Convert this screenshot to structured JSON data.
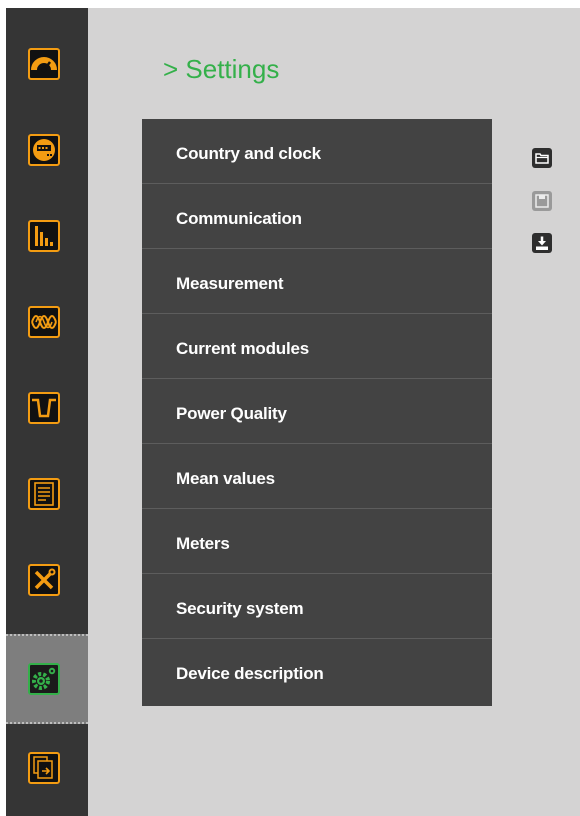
{
  "header": {
    "title": "> Settings"
  },
  "sidebar": {
    "items": [
      {
        "icon": "gauge-icon",
        "active": false
      },
      {
        "icon": "meter-icon",
        "active": false
      },
      {
        "icon": "bar-chart-icon",
        "active": false
      },
      {
        "icon": "waveform-icon",
        "active": false
      },
      {
        "icon": "voltage-dip-icon",
        "active": false
      },
      {
        "icon": "report-list-icon",
        "active": false
      },
      {
        "icon": "tools-icon",
        "active": false
      },
      {
        "icon": "settings-gear-icon",
        "active": true
      },
      {
        "icon": "documents-export-icon",
        "active": false
      }
    ],
    "accent_color": "#f39c12",
    "active_color": "#34b04a"
  },
  "settings_menu": {
    "items": [
      {
        "label": "Country and clock"
      },
      {
        "label": "Communication"
      },
      {
        "label": "Measurement"
      },
      {
        "label": "Current modules"
      },
      {
        "label": "Power Quality"
      },
      {
        "label": "Mean values"
      },
      {
        "label": "Meters"
      },
      {
        "label": "Security system"
      },
      {
        "label": "Device description"
      }
    ]
  },
  "toolbar": {
    "buttons": [
      {
        "icon": "folder-open-icon",
        "enabled": true
      },
      {
        "icon": "save-icon",
        "enabled": false
      },
      {
        "icon": "download-icon",
        "enabled": true
      }
    ]
  },
  "colors": {
    "background": "#d4d3d3",
    "sidebar": "#353535",
    "menu": "#434343",
    "title": "#34b04a"
  }
}
